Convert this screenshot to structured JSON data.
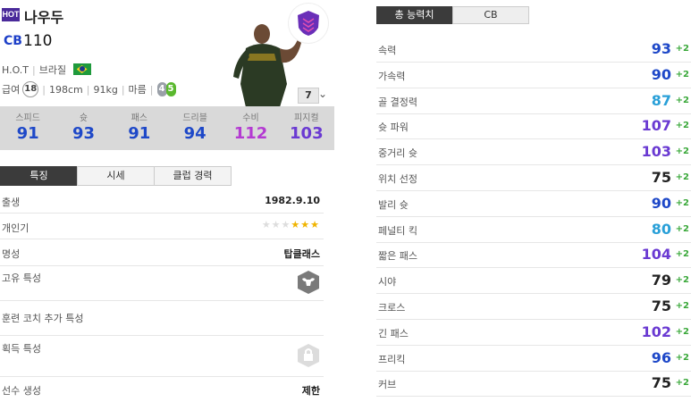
{
  "player": {
    "badge": "HOT",
    "name": "나우두",
    "position": "CB",
    "overall": "110",
    "season": "H.O.T",
    "nation": "브라질",
    "salary": "18",
    "height": "198cm",
    "weight": "91kg",
    "body": "마름",
    "skill_left": "4",
    "skill_right": "5",
    "level": "7"
  },
  "stats": [
    {
      "label": "스피드",
      "value": "91",
      "color": "#1e48c8"
    },
    {
      "label": "슛",
      "value": "93",
      "color": "#1e48c8"
    },
    {
      "label": "패스",
      "value": "91",
      "color": "#1e48c8"
    },
    {
      "label": "드리블",
      "value": "94",
      "color": "#1e48c8"
    },
    {
      "label": "수비",
      "value": "112",
      "color": "#b43ad2"
    },
    {
      "label": "피지컬",
      "value": "103",
      "color": "#6a3ad2"
    }
  ],
  "tabs": [
    "특징",
    "시세",
    "클럽 경력"
  ],
  "rows": {
    "birth": {
      "label": "출생",
      "value": "1982.9.10"
    },
    "popularity": {
      "label": "개인기"
    },
    "reputation": {
      "label": "명성",
      "value": "탑클래스"
    },
    "unique": {
      "label": "고유 특성"
    },
    "coach": {
      "label": "훈련 코치 추가 특성"
    },
    "acquired": {
      "label": "획득 특성"
    },
    "gen": {
      "label": "선수 생성",
      "value": "제한"
    }
  },
  "right_tabs": [
    "총 능력치",
    "CB"
  ],
  "attributes": [
    {
      "label": "속력",
      "value": "93",
      "bonus": "+2",
      "color": "#1e48c8"
    },
    {
      "label": "가속력",
      "value": "90",
      "bonus": "+2",
      "color": "#1e48c8"
    },
    {
      "label": "골 결정력",
      "value": "87",
      "bonus": "+2",
      "color": "#2aa0d8"
    },
    {
      "label": "슛 파워",
      "value": "107",
      "bonus": "+2",
      "color": "#6a3ad2"
    },
    {
      "label": "중거리 슛",
      "value": "103",
      "bonus": "+2",
      "color": "#6a3ad2"
    },
    {
      "label": "위치 선정",
      "value": "75",
      "bonus": "+2",
      "color": "#222222"
    },
    {
      "label": "발리 슛",
      "value": "90",
      "bonus": "+2",
      "color": "#1e48c8"
    },
    {
      "label": "페널티 킥",
      "value": "80",
      "bonus": "+2",
      "color": "#2aa0d8"
    },
    {
      "label": "짧은 패스",
      "value": "104",
      "bonus": "+2",
      "color": "#6a3ad2"
    },
    {
      "label": "시야",
      "value": "79",
      "bonus": "+2",
      "color": "#222222"
    },
    {
      "label": "크로스",
      "value": "75",
      "bonus": "+2",
      "color": "#222222"
    },
    {
      "label": "긴 패스",
      "value": "102",
      "bonus": "+2",
      "color": "#6a3ad2"
    },
    {
      "label": "프리킥",
      "value": "96",
      "bonus": "+2",
      "color": "#1e48c8"
    },
    {
      "label": "커브",
      "value": "75",
      "bonus": "+2",
      "color": "#222222"
    }
  ]
}
